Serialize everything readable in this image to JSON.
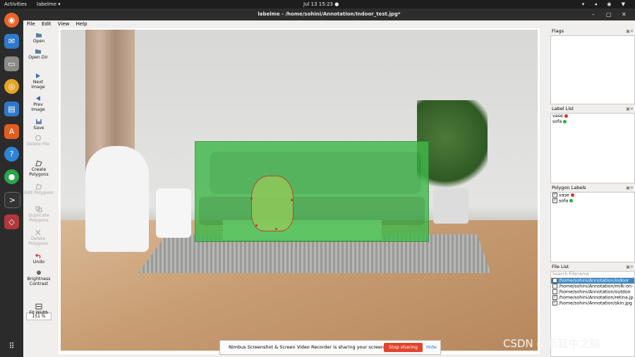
{
  "topbar": {
    "activities": "Activities",
    "app": "labelme ▾",
    "clock": "Jul 13  15:23  ●",
    "tray": "▾ ◂ ◉ ▼"
  },
  "window": {
    "title": "labelme - /home/sohini/Annotation/Indoor_test.jpg*"
  },
  "menu": [
    "File",
    "Edit",
    "View",
    "Help"
  ],
  "tools": [
    {
      "label": "Open",
      "icon": "open-icon",
      "enabled": true
    },
    {
      "label": "Open Dir",
      "icon": "open-dir-icon",
      "enabled": true
    },
    {
      "label": "Next Image",
      "icon": "next-icon",
      "enabled": true
    },
    {
      "label": "Prev Image",
      "icon": "prev-icon",
      "enabled": true
    },
    {
      "label": "Save",
      "icon": "save-icon",
      "enabled": true
    },
    {
      "label": "Delete File",
      "icon": "delete-file-icon",
      "enabled": false
    },
    {
      "label": "Create Polygons",
      "icon": "create-polygon-icon",
      "enabled": true
    },
    {
      "label": "Edit Polygons",
      "icon": "edit-polygon-icon",
      "enabled": false
    },
    {
      "label": "Duplicate Polygons",
      "icon": "duplicate-icon",
      "enabled": false
    },
    {
      "label": "Delete Polygons",
      "icon": "delete-polygon-icon",
      "enabled": false
    },
    {
      "label": "Undo",
      "icon": "undo-icon",
      "enabled": true
    },
    {
      "label": "Brightness Contrast",
      "icon": "brightness-icon",
      "enabled": true
    },
    {
      "label": "Fit Width",
      "icon": "fit-width-icon",
      "enabled": true
    }
  ],
  "zoom": "151 %",
  "panels": {
    "flags": "Flags",
    "label_list": {
      "title": "Label List",
      "items": [
        {
          "name": "vase",
          "color": "#d63a2e"
        },
        {
          "name": "sofa",
          "color": "#2bb03a"
        }
      ]
    },
    "polygon_labels": {
      "title": "Polygon Labels",
      "items": [
        {
          "name": "vase",
          "color": "#d63a2e"
        },
        {
          "name": "sofa",
          "color": "#2bb03a"
        }
      ]
    },
    "file_list": {
      "title": "File List",
      "search_placeholder": "Search Filename",
      "files": [
        {
          "path": "/home/sohini/Annotation/indoor",
          "checked": false,
          "selected": true
        },
        {
          "path": "/home/sohini/Annotation/milk-on-",
          "checked": false,
          "selected": false
        },
        {
          "path": "/home/sohini/Annotation/outdoo",
          "checked": false,
          "selected": false
        },
        {
          "path": "/home/sohini/Annotation/retina.jp",
          "checked": true,
          "selected": false
        },
        {
          "path": "/home/sohini/Annotation/skin.jpg",
          "checked": true,
          "selected": false
        }
      ]
    }
  },
  "sharing": {
    "message": "Nimbus Screenshot & Screen Video Recorder is sharing your screen.",
    "stop": "Stop sharing",
    "hide": "Hide"
  },
  "watermark": "CSDN @新缸中之脑",
  "colors": {
    "sofa": "#41b84a",
    "vase": "#d63a2e",
    "selection": "#3b87c4"
  }
}
